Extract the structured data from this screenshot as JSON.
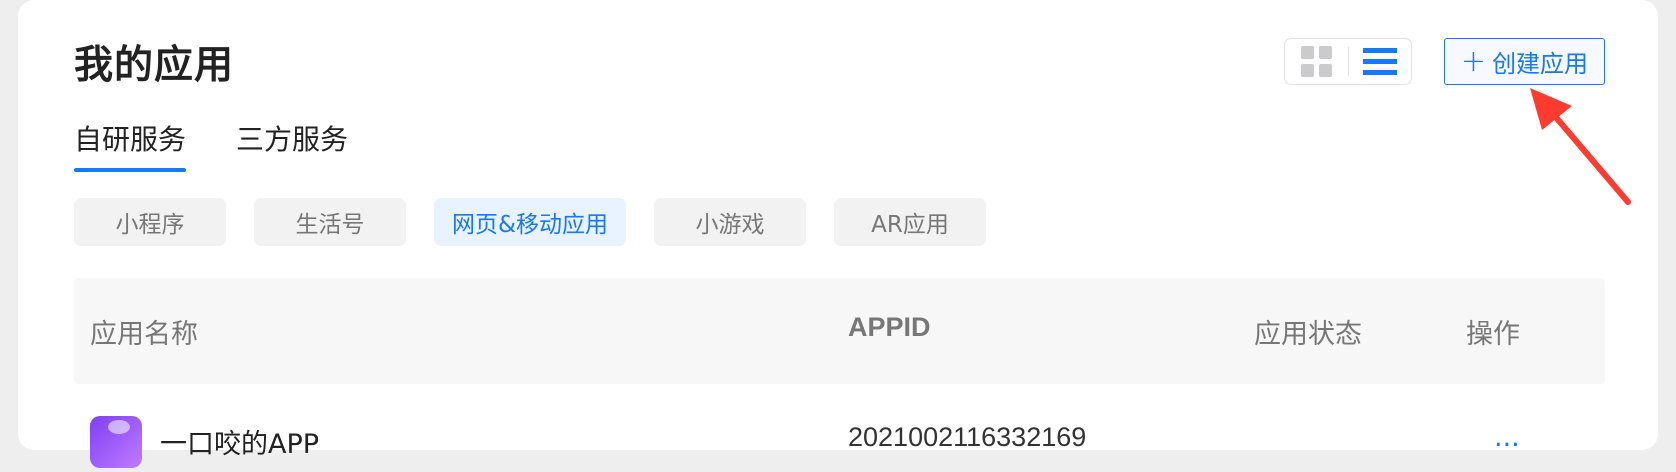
{
  "page": {
    "title": "我的应用"
  },
  "view_toggle": {
    "grid_icon": "grid-icon",
    "list_icon": "list-icon",
    "selected": "list"
  },
  "create_button": {
    "label": "创建应用",
    "plus": "+"
  },
  "tabs": [
    {
      "label": "自研服务",
      "active": true
    },
    {
      "label": "三方服务",
      "active": false
    }
  ],
  "filters": [
    {
      "label": "小程序",
      "active": false
    },
    {
      "label": "生活号",
      "active": false
    },
    {
      "label": "网页&移动应用",
      "active": true
    },
    {
      "label": "小游戏",
      "active": false
    },
    {
      "label": "AR应用",
      "active": false
    }
  ],
  "table": {
    "headers": {
      "name": "应用名称",
      "appid": "APPID",
      "status": "应用状态",
      "op": "操作"
    },
    "rows": [
      {
        "name": "一口咬的APP",
        "appid": "2021002116332169",
        "status": "",
        "op": "..."
      }
    ]
  },
  "colors": {
    "accent": "#1677ff",
    "annotation_arrow": "#ff3b30"
  }
}
